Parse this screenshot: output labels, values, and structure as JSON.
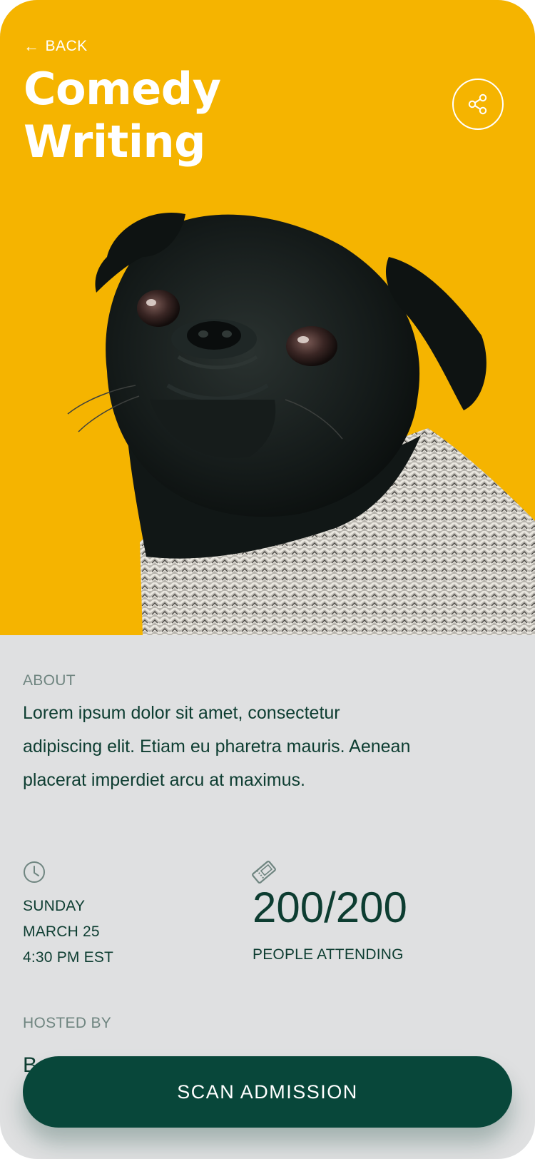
{
  "nav": {
    "back_arrow": "←",
    "back_label": "BACK"
  },
  "event": {
    "title": "Comedy Writing",
    "share_icon": "share-icon"
  },
  "about": {
    "label": "ABOUT",
    "text": "Lorem ipsum dolor sit amet, consectetur adipiscing elit. Etiam eu pharetra mauris. Aenean placerat imperdiet arcu at maximus."
  },
  "schedule": {
    "icon": "clock-icon",
    "day": "SUNDAY",
    "date": "MARCH 25",
    "time": "4:30 PM EST"
  },
  "attendance": {
    "icon": "ticket-icon",
    "count": "200/200",
    "label": "PEOPLE ATTENDING"
  },
  "host": {
    "label": "HOSTED BY",
    "name": "B"
  },
  "actions": {
    "scan_label": "SCAN ADMISSION"
  },
  "colors": {
    "hero_background": "#f5b400",
    "content_background": "#dfe0e1",
    "text_dark_green": "#0d3d31",
    "label_muted": "#6f8580",
    "button_background": "#08473a"
  }
}
